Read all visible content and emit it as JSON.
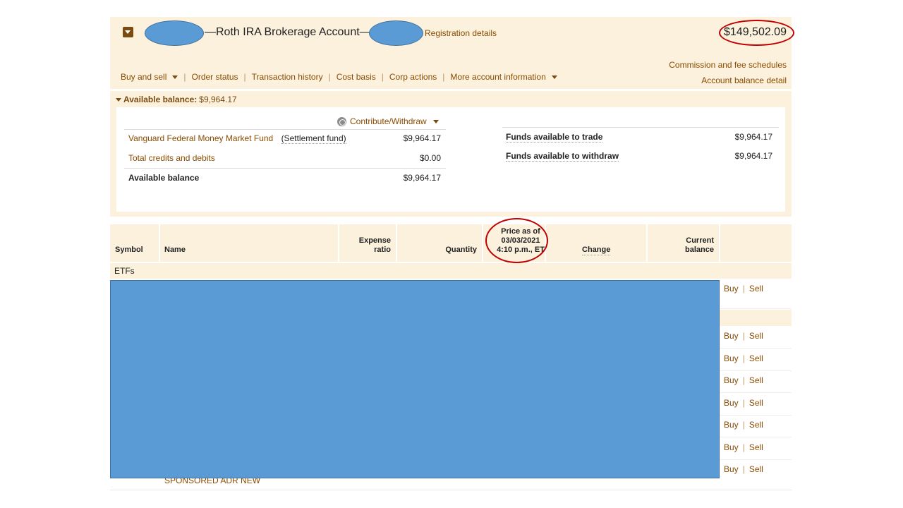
{
  "account": {
    "title": "—Roth IRA Brokerage Account—",
    "registration_link": "Registration details",
    "total_value": "$149,502.09"
  },
  "right_links": {
    "commission": "Commission and fee schedules",
    "balance_detail": "Account balance detail"
  },
  "nav": {
    "buy_sell": "Buy and sell",
    "order_status": "Order status",
    "transaction_history": "Transaction history",
    "cost_basis": "Cost basis",
    "corp_actions": "Corp actions",
    "more_info": "More account information",
    "separator": "|"
  },
  "available": {
    "header_label": "Available balance:",
    "header_value": "$9,964.17",
    "contribute_label": "Contribute/Withdraw",
    "rows": [
      {
        "label": "Vanguard Federal Money Market Fund",
        "sub": "(Settlement fund)",
        "value": "$9,964.17"
      },
      {
        "label": "Total credits and debits",
        "value": "$0.00"
      },
      {
        "label": "Available balance",
        "value": "$9,964.17"
      }
    ],
    "funds": [
      {
        "label": "Funds available to trade",
        "value": "$9,964.17"
      },
      {
        "label": "Funds available to withdraw",
        "value": "$9,964.17"
      }
    ]
  },
  "table": {
    "headers": {
      "symbol": "Symbol",
      "name": "Name",
      "expense_line1": "Expense",
      "expense_line2": "ratio",
      "quantity": "Quantity",
      "price_line1": "Price as of",
      "price_line2": "03/03/2021",
      "price_line3": "4:10 p.m., ET",
      "change": "Change",
      "current_line1": "Current",
      "current_line2": "balance"
    },
    "group_label": "ETFs",
    "actions": {
      "buy": "Buy",
      "sell": "Sell",
      "separator": "|"
    },
    "partial_name": "SPONSORED ADR NEW"
  },
  "colors": {
    "brand_brown": "#8a4b00",
    "panel_bg": "#fbf1dd",
    "redaction_blue": "#5b9bd5",
    "annotation_red": "#c00000"
  }
}
